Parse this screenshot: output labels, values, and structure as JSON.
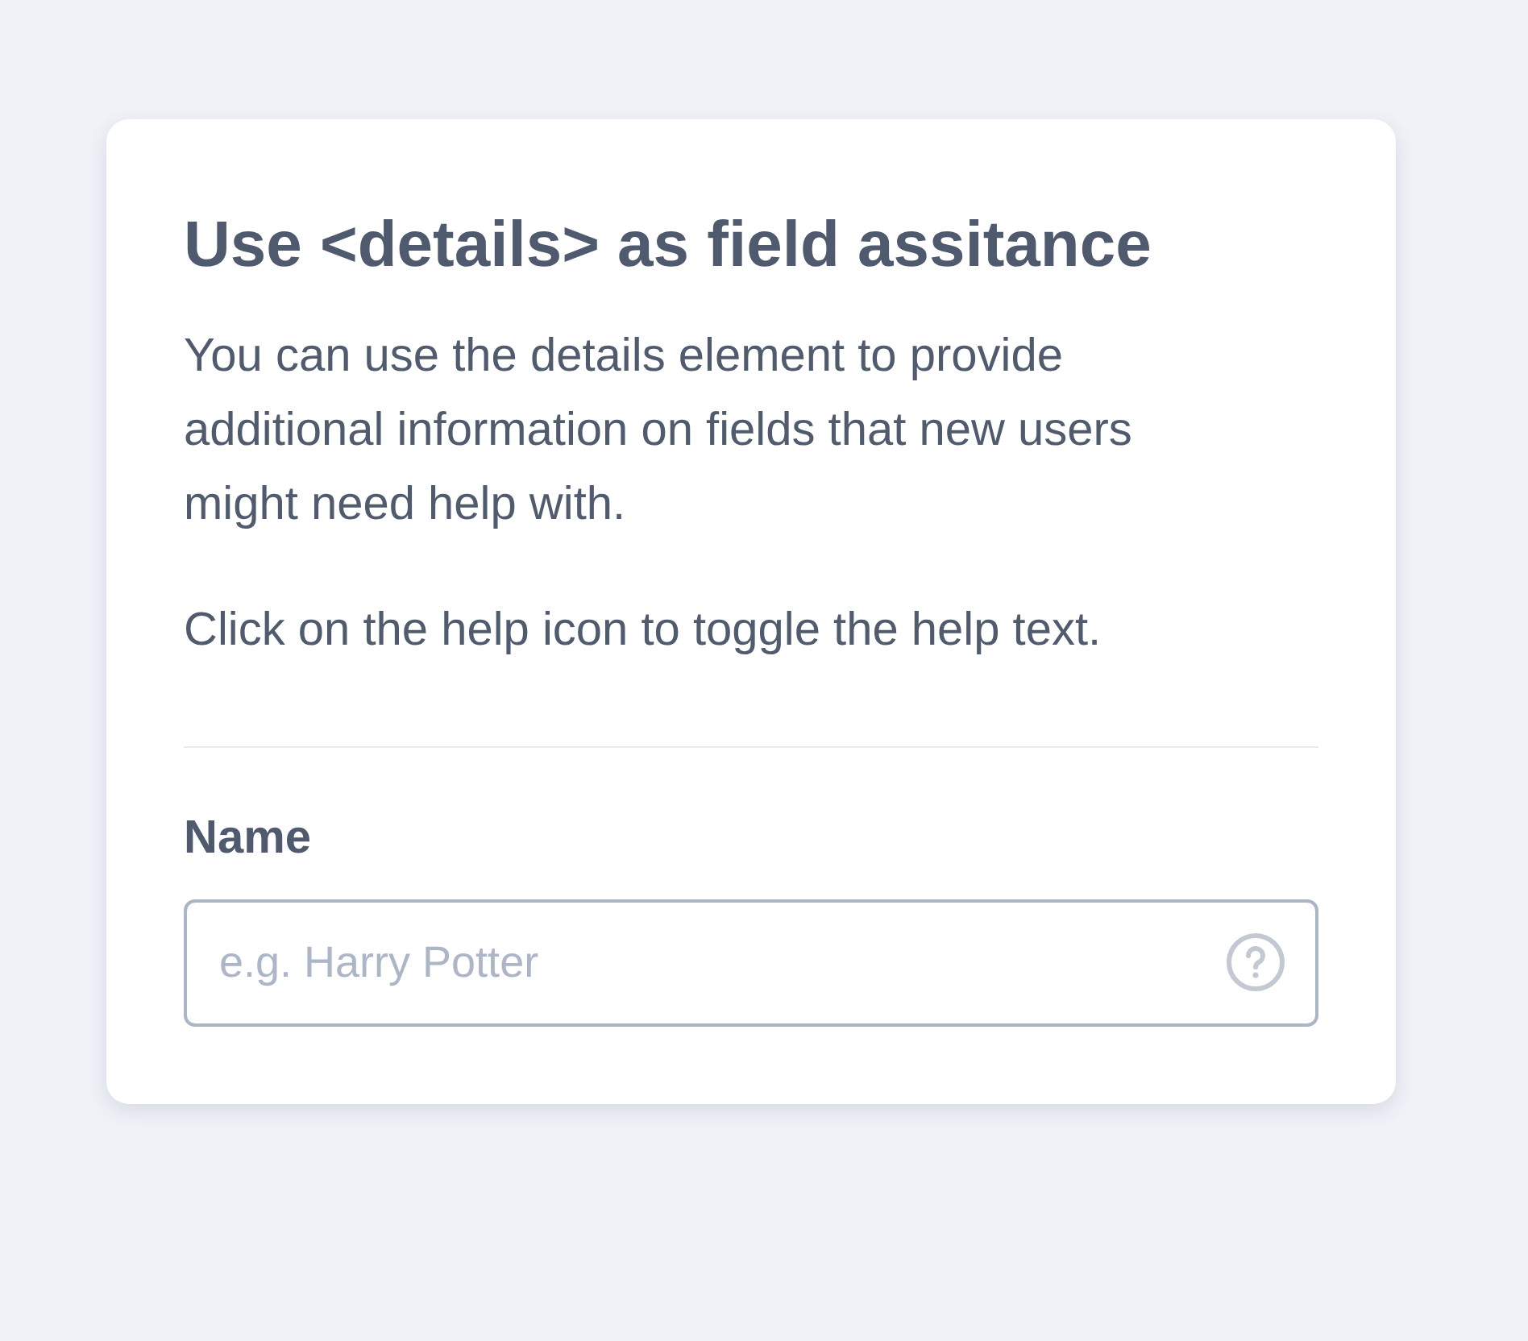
{
  "card": {
    "title": "Use <details> as field assitance",
    "paragraphs": [
      "You can use the details element to provide additional information on fields that new users might need help with.",
      "Click on the help icon to toggle the help text."
    ],
    "field": {
      "label": "Name",
      "placeholder": "e.g. Harry Potter"
    }
  }
}
